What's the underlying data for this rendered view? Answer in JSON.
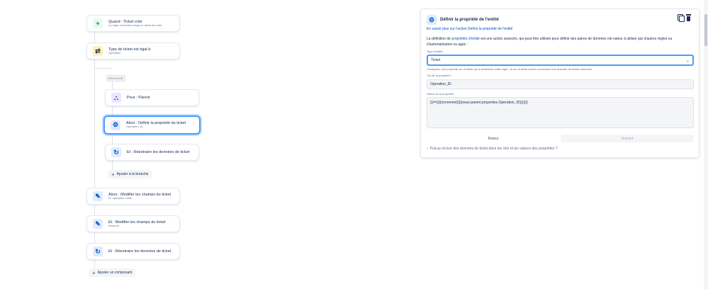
{
  "flow": {
    "trigger": {
      "title": "Quand : Ticket créé",
      "sub": "La règle s'exécute lorsqu'un ticket est créé"
    },
    "condition": {
      "title": "Type de ticket est égal à",
      "sub": "Opération"
    },
    "branch_badge": "BRANCHE",
    "branch_for": {
      "title": "Pour : Parent"
    },
    "branch_action": {
      "title": "Alors : Définir la propriété du ticket",
      "sub": "Operation_ID"
    },
    "branch_and": {
      "title": "Et : Réextraire les données de ticket"
    },
    "add_to_branch": "Ajouter à la branche",
    "edit1": {
      "title": "Alors : Modifier les champs du ticket",
      "sub": "N° opération, Date"
    },
    "edit2": {
      "title": "Et : Modifier les champs du ticket",
      "sub": "Résumé"
    },
    "refetch": {
      "title": "Et : Réextraire les données de ticket"
    },
    "add_component": "Ajouter un composant"
  },
  "panel": {
    "title": "Définir la propriété de l'entité",
    "learn_more": "En savoir plus sur l'action Définir la propriété de l'entité",
    "desc_prefix": "La définition de ",
    "desc_link": "propriétés d'entité",
    "desc_suffix": " est une action avancée, qui peut être utilisée pour définir des paires de données clé-valeur à utiliser par d'autres règles ou d'automatisation ou apps :",
    "entity_type_label": "Type d'entité",
    "entity_type_value": "Ticket",
    "entity_type_hint": "Configurez une propriété sur le ticket qui a déclenché cette règle, ou sur le ticket actuel concernant une branche de tickets associés.",
    "key_label": "Clé de la propriété *",
    "key_value": "Operation_ID",
    "value_label": "Valeur de la propriété",
    "value_value": "{{#=}}{{increment}}{{issue.parent.properties.Operation_ID}}{{/}}",
    "back_label": "Retour",
    "next_label": "Suivant",
    "faq": "Puis-je inclure des données de ticket dans les clés et les valeurs des propriétés ?"
  }
}
